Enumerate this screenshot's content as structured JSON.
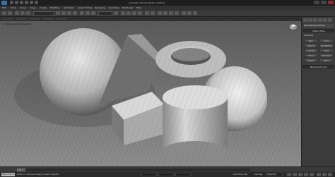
{
  "window": {
    "title": "Autodesk 3ds Max 2015 (untitled)",
    "controls": [
      "minimize",
      "maximize",
      "close"
    ]
  },
  "menu": [
    "Edit",
    "Tools",
    "Group",
    "Views",
    "Create",
    "Modifiers",
    "Animation",
    "Graph Editors",
    "Rendering",
    "Customize",
    "MAXScript",
    "Help"
  ],
  "viewport": {
    "label": "[+] [Perspective] [Realistic]",
    "background": "#7d7d7d"
  },
  "command_panel": {
    "dropdown": "Standard Primitives",
    "object_type_header": "Object Type",
    "autogrid": "AutoGrid",
    "buttons": [
      "Box",
      "Cone",
      "Sphere",
      "GeoSphere",
      "Cylinder",
      "Tube",
      "Torus",
      "Pyramid",
      "Teapot",
      "Plane"
    ],
    "name_color_header": "Name and Color"
  },
  "timeline": {
    "frame": "0 / 100"
  },
  "status_bar": {
    "maxscript_label": "Welcome to MAX",
    "prompt": "Click or click-and-drag to select objects",
    "add_time_tag": "Add Time Tag",
    "set_key": "Set Key",
    "selected": "Selected"
  }
}
